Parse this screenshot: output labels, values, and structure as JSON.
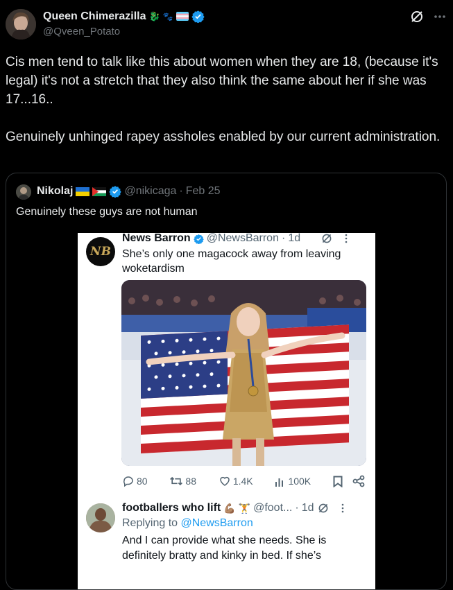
{
  "post": {
    "author_name": "Queen Chimerazilla",
    "author_handle": "@Qveen_Potato",
    "text": "Cis men tend to talk like this about women when they are 18, (because it's legal) it's not a stretch that they also think the same about her if she was 17...16..\n\nGenuinely unhinged rapey assholes enabled by our current administration."
  },
  "quote": {
    "author_name": "Nikolaj",
    "author_handle": "@nikicaga",
    "date": "Feb 25",
    "text": "Genuinely these guys are not human"
  },
  "screenshot": {
    "tweet": {
      "logo_text": "NB",
      "author_name": "News Barron",
      "author_handle": "@NewsBarron",
      "age": "1d",
      "text": "She’s only one magacock away from leaving woketardism",
      "stats": {
        "replies": "80",
        "reposts": "88",
        "likes": "1.4K",
        "views": "100K"
      }
    },
    "reply": {
      "author_name": "footballers who lift",
      "author_handle": "@foot...",
      "age": "1d",
      "replying_prefix": "Replying to",
      "replying_to": "@NewsBarron",
      "text": "And I can provide what she needs. She is definitely bratty and kinky in bed. If she’s"
    }
  },
  "colors": {
    "background": "#000000",
    "text_primary": "#e7e9ea",
    "text_secondary": "#71767b",
    "verified": "#1d9bf0",
    "border": "#2f3336"
  }
}
